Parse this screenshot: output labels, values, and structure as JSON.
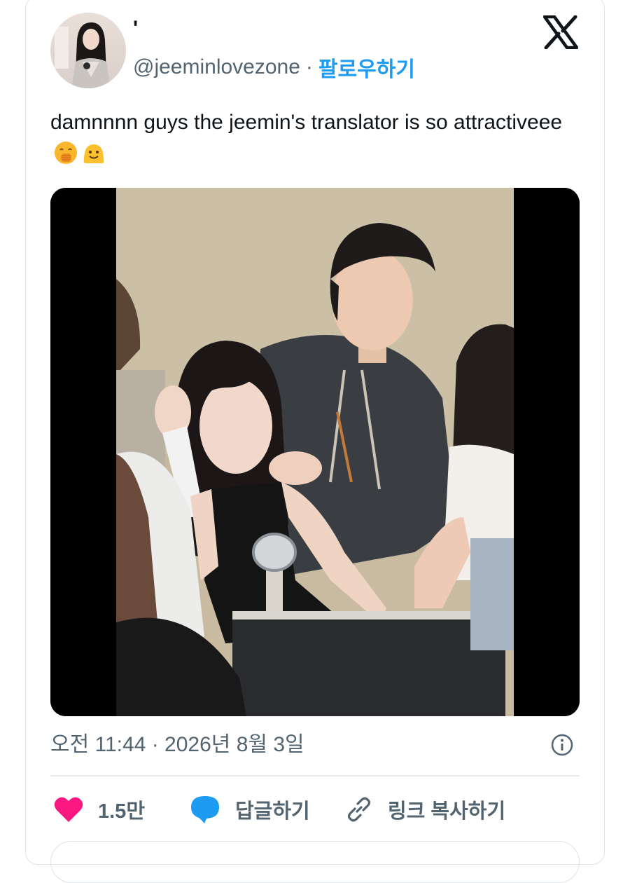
{
  "author": {
    "display_name": "'",
    "handle": "@jeeminlovezone",
    "separator": "·",
    "follow_label": "팔로우하기"
  },
  "tweet": {
    "text": "damnnnn guys the jeemin's translator is so attractiveee",
    "emojis": [
      "face-with-hand-over-mouth",
      "melting-face"
    ]
  },
  "media": {
    "type": "video-still",
    "description_icon": "photo"
  },
  "meta": {
    "timestamp": "오전 11:44 · 2026년 8월 3일"
  },
  "actions": {
    "like_count": "1.5만",
    "reply_label": "답글하기",
    "copy_link_label": "링크 복사하기"
  },
  "colors": {
    "like": "#f91880",
    "reply": "#1d9bf0",
    "follow": "#1d9bf0",
    "secondary_text": "#536471"
  }
}
